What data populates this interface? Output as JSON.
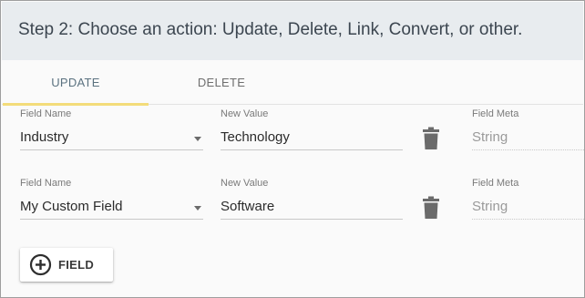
{
  "header": {
    "title": "Step 2: Choose an action: Update, Delete, Link, Convert, or other."
  },
  "tabs": [
    {
      "label": "UPDATE",
      "active": true
    },
    {
      "label": "DELETE",
      "active": false
    }
  ],
  "rows": [
    {
      "field_name_label": "Field Name",
      "field_name": "Industry",
      "new_value_label": "New Value",
      "new_value": "Technology",
      "field_meta_label": "Field Meta",
      "field_meta": "String"
    },
    {
      "field_name_label": "Field Name",
      "field_name": "My Custom Field",
      "new_value_label": "New Value",
      "new_value": "Software",
      "field_meta_label": "Field Meta",
      "field_meta": "String"
    }
  ],
  "add_button": {
    "label": "FIELD",
    "icon": "plus-circle-icon"
  },
  "colors": {
    "header_bg": "#e8ecef",
    "active_tab_indicator": "#f3dc7a",
    "active_tab_text": "#5b7280",
    "icon_gray": "#6b6b6b"
  }
}
